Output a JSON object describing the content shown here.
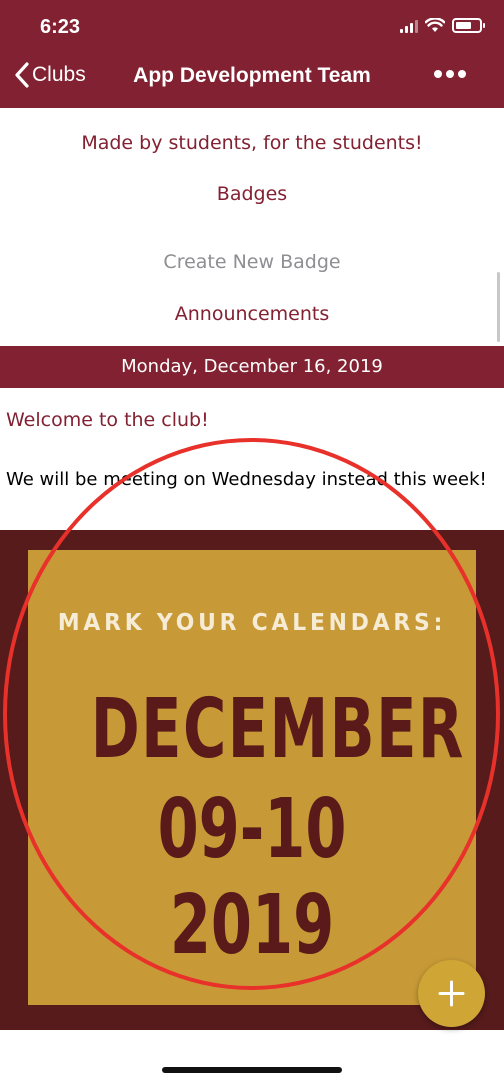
{
  "status_bar": {
    "time": "6:23"
  },
  "nav": {
    "back_label": "Clubs",
    "title": "App Development Team"
  },
  "club": {
    "tagline": "Made by students, for the students!",
    "badges_heading": "Badges",
    "create_badge_label": "Create New Badge",
    "announcements_heading": "Announcements"
  },
  "announcement": {
    "date": "Monday, December 16, 2019",
    "title": "Welcome to the club!",
    "body": "We will be meeting on Wednesday instead this week!"
  },
  "poster": {
    "line1": "MARK YOUR CALENDARS:",
    "month": "DECEMBER",
    "days": "09-10",
    "year": "2019"
  },
  "colors": {
    "brand": "#822131",
    "poster_background": "#571b1c",
    "poster_card": "#c89a37",
    "fab": "#cfa536",
    "highlight": "#e8312a"
  },
  "icons": {
    "back": "chevron-left-icon",
    "more": "more-horizontal-icon",
    "fab": "plus-icon"
  }
}
